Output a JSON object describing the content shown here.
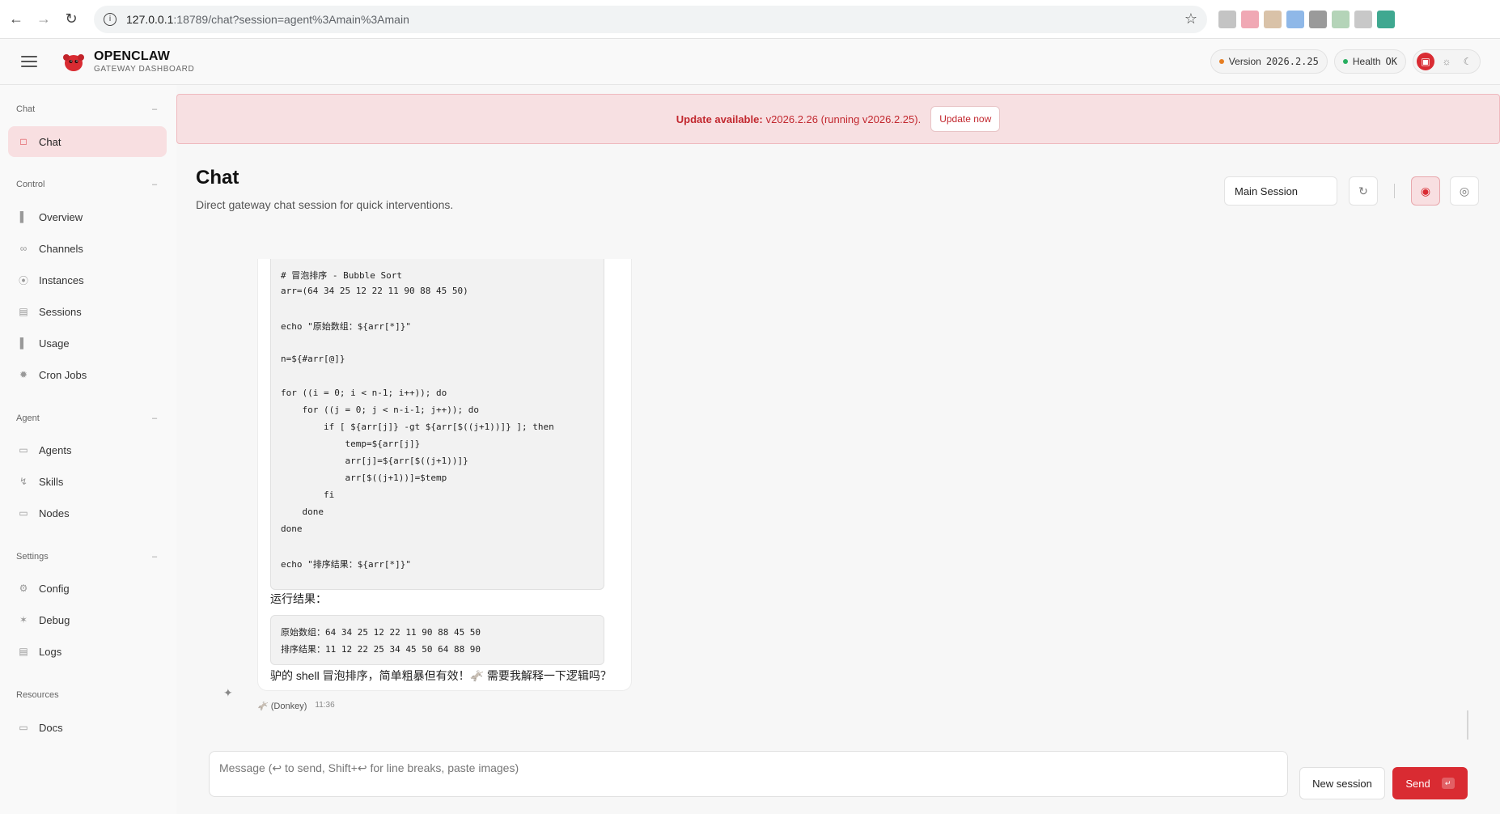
{
  "browser": {
    "url_host": "127.0.0.1",
    "url_rest": ":18789/chat?session=agent%3Amain%3Amain",
    "extension_colors": [
      "#c4c4c4",
      "#f0a8b4",
      "#d9c2a8",
      "#8fb8e8",
      "#9a9a9a",
      "#b4d4b8",
      "#c8c8c8",
      "#3fa890"
    ]
  },
  "header": {
    "brand_name": "OPENCLAW",
    "brand_sub": "GATEWAY DASHBOARD",
    "version_label": "Version",
    "version_value": "2026.2.25",
    "health_label": "Health",
    "health_value": "OK"
  },
  "sidebar": {
    "sections": [
      {
        "title": "Chat",
        "items": [
          {
            "label": "Chat",
            "icon": "chat-icon",
            "active": true
          }
        ]
      },
      {
        "title": "Control",
        "items": [
          {
            "label": "Overview",
            "icon": "bar-chart-icon"
          },
          {
            "label": "Channels",
            "icon": "link-icon"
          },
          {
            "label": "Instances",
            "icon": "broadcast-icon"
          },
          {
            "label": "Sessions",
            "icon": "document-icon"
          },
          {
            "label": "Usage",
            "icon": "bar-chart-icon"
          },
          {
            "label": "Cron Jobs",
            "icon": "loader-icon"
          }
        ]
      },
      {
        "title": "Agent",
        "items": [
          {
            "label": "Agents",
            "icon": "folder-icon"
          },
          {
            "label": "Skills",
            "icon": "bolt-icon"
          },
          {
            "label": "Nodes",
            "icon": "monitor-icon"
          }
        ]
      },
      {
        "title": "Settings",
        "items": [
          {
            "label": "Config",
            "icon": "gear-icon"
          },
          {
            "label": "Debug",
            "icon": "bug-icon"
          },
          {
            "label": "Logs",
            "icon": "scroll-icon"
          }
        ]
      },
      {
        "title": "Resources",
        "items": [
          {
            "label": "Docs",
            "icon": "book-icon"
          }
        ]
      }
    ]
  },
  "banner": {
    "strong": "Update available:",
    "text": "v2026.2.26 (running v2026.2.25).",
    "button": "Update now"
  },
  "page": {
    "title": "Chat",
    "subtitle": "Direct gateway chat session for quick interventions.",
    "session_select": "Main Session"
  },
  "chat": {
    "code_lines": [
      "# 冒泡排序 - Bubble Sort",
      "arr=(64 34 25 12 22 11 90 88 45 50)",
      "",
      "echo \"原始数组：${arr[*]}\"",
      "",
      "n=${#arr[@]}",
      "",
      "for ((i = 0; i < n-1; i++)); do",
      "    for ((j = 0; j < n-i-1; j++)); do",
      "        if [ ${arr[j]} -gt ${arr[$((j+1))]} ]; then",
      "            temp=${arr[j]}",
      "            arr[j]=${arr[$((j+1))]}",
      "            arr[$((j+1))]=$temp",
      "        fi",
      "    done",
      "done",
      "",
      "echo \"排序结果：${arr[*]}\""
    ],
    "result_label": "运行结果：",
    "output_lines": [
      "原始数组：64 34 25 12 22 11 90 88 45 50",
      "排序结果：11 12 22 25 34 45 50 64 88 90"
    ],
    "closing": "驴的 shell 冒泡排序，简单粗暴但有效！🫏 需要我解释一下逻辑吗？",
    "sender": "🫏 (Donkey)",
    "time": "11:36"
  },
  "composer": {
    "placeholder": "Message (↩ to send, Shift+↩ for line breaks, paste images)",
    "new_session": "New session",
    "send": "Send"
  }
}
